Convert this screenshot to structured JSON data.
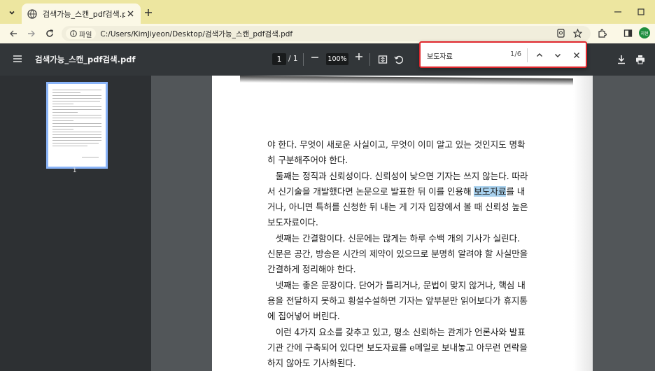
{
  "browser": {
    "tab": {
      "title": "검색가능_스캔_pdf검색.pdf"
    },
    "address": {
      "site_chip": "파일",
      "url": "C:/Users/KimJiyeon/Desktop/검색가능_스캔_pdf검색.pdf"
    },
    "profile_initials": "지현"
  },
  "pdf_toolbar": {
    "doc_title": "검색가능_스캔_pdf검색.pdf",
    "current_page": "1",
    "page_sep": "/ 1",
    "zoom": "100%"
  },
  "find": {
    "query": "보도자료",
    "count": "1/6"
  },
  "sidebar": {
    "thumb_number": "1"
  },
  "page": {
    "lines": [
      {
        "before": "야 한다. 무엇이 새로운 사실이고, 무엇이 이미 알고 있는 것인지도 명확",
        "match": "",
        "after": ""
      },
      {
        "before": "히 구분해주어야 한다.",
        "match": "",
        "after": ""
      },
      {
        "before": "   둘째는 정직과 신뢰성이다. 신뢰성이 낮으면 기자는 쓰지 않는다. 따라",
        "match": "",
        "after": ""
      },
      {
        "before": "서 신기술을 개발했다면 논문으로 발표한 뒤 이를 인용해 ",
        "match": "보도자료",
        "after": "를 내"
      },
      {
        "before": "거나, 아니면 특허를 신청한 뒤 내는 게 기자 입장에서 볼 때 신뢰성 높은",
        "match": "",
        "after": ""
      },
      {
        "before": "보도자료이다.",
        "match": "",
        "after": ""
      },
      {
        "before": "   셋째는 간결함이다. 신문에는 많게는 하루 수백 개의 기사가 실린다.",
        "match": "",
        "after": ""
      },
      {
        "before": "신문은 공간, 방송은 시간의 제약이 있으므로 분명히 알려야 할 사실만을",
        "match": "",
        "after": ""
      },
      {
        "before": "간결하게 정리해야 한다.",
        "match": "",
        "after": ""
      },
      {
        "before": "   넷째는 좋은 문장이다. 단어가 틀리거나, 문법이 맞지 않거나, 핵심 내",
        "match": "",
        "after": ""
      },
      {
        "before": "용을 전달하지 못하고 횡설수설하면 기자는 앞부분만 읽어보다가 휴지통",
        "match": "",
        "after": ""
      },
      {
        "before": "에 집어넣어 버린다.",
        "match": "",
        "after": ""
      },
      {
        "before": "   이런 4가지 요소를 갖추고 있고, 평소 신뢰하는 관계가 언론사와 발표",
        "match": "",
        "after": ""
      },
      {
        "before": "기관 간에 구축되어 있다면 보도자료를 e메일로 보내놓고 아무런 연락을",
        "match": "",
        "after": ""
      },
      {
        "before": "하지 않아도 기사화된다.",
        "match": "",
        "after": ""
      }
    ]
  },
  "colors": {
    "tabstrip": "#ede6a0",
    "pdf_toolbar": "#323639",
    "sidebar": "#2d3033",
    "viewer_bg": "#525659",
    "find_border": "#e0282e",
    "highlight": "#a8d1ee"
  }
}
